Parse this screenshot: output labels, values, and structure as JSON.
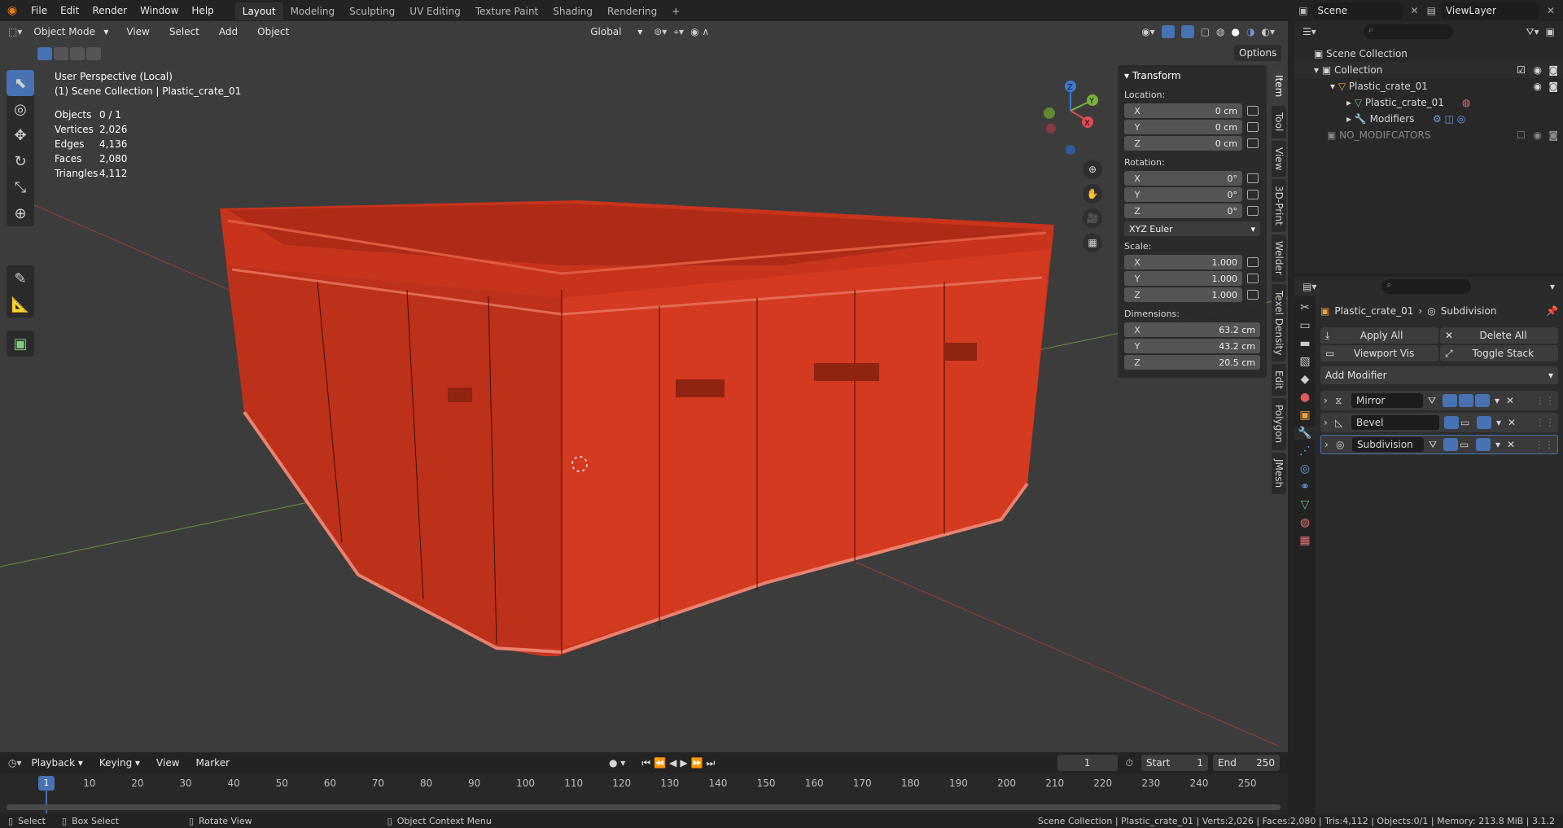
{
  "topmenu": {
    "items": [
      "File",
      "Edit",
      "Render",
      "Window",
      "Help"
    ],
    "workspaces": [
      "Layout",
      "Modeling",
      "Sculpting",
      "UV Editing",
      "Texture Paint",
      "Shading",
      "Rendering"
    ],
    "add_tab": "+",
    "scene": "Scene",
    "view_layer": "ViewLayer"
  },
  "viewport_header": {
    "mode": "Object Mode",
    "menus": [
      "View",
      "Select",
      "Add",
      "Object"
    ],
    "transform_orientation": "Global",
    "options": "Options"
  },
  "viewport": {
    "perspective": "User Perspective (Local)",
    "collection_line": "(1) Scene Collection | Plastic_crate_01",
    "stats": [
      {
        "label": "Objects",
        "value": "0 / 1"
      },
      {
        "label": "Vertices",
        "value": "2,026"
      },
      {
        "label": "Edges",
        "value": "4,136"
      },
      {
        "label": "Faces",
        "value": "2,080"
      },
      {
        "label": "Triangles",
        "value": "4,112"
      }
    ],
    "gizmo": {
      "x": "X",
      "y": "Y",
      "z": "Z"
    },
    "mesh_color": "#d9391f"
  },
  "npanel": {
    "title": "Transform",
    "location_label": "Location:",
    "location": [
      {
        "axis": "X",
        "value": "0 cm"
      },
      {
        "axis": "Y",
        "value": "0 cm"
      },
      {
        "axis": "Z",
        "value": "0 cm"
      }
    ],
    "rotation_label": "Rotation:",
    "rotation": [
      {
        "axis": "X",
        "value": "0°"
      },
      {
        "axis": "Y",
        "value": "0°"
      },
      {
        "axis": "Z",
        "value": "0°"
      }
    ],
    "rotation_mode": "XYZ Euler",
    "scale_label": "Scale:",
    "scale": [
      {
        "axis": "X",
        "value": "1.000"
      },
      {
        "axis": "Y",
        "value": "1.000"
      },
      {
        "axis": "Z",
        "value": "1.000"
      }
    ],
    "dimensions_label": "Dimensions:",
    "dimensions": [
      {
        "axis": "X",
        "value": "63.2 cm"
      },
      {
        "axis": "Y",
        "value": "43.2 cm"
      },
      {
        "axis": "Z",
        "value": "20.5 cm"
      }
    ],
    "tabs": [
      "Item",
      "Tool",
      "View",
      "3D-Print",
      "Welder",
      "Texel Density",
      "Edit",
      "Polygon",
      "JMesh"
    ]
  },
  "outliner": {
    "rows": [
      {
        "label": "Scene Collection"
      },
      {
        "label": "Collection"
      },
      {
        "label": "Plastic_crate_01"
      },
      {
        "label": "Plastic_crate_01"
      },
      {
        "label": "Modifiers"
      },
      {
        "label": "NO_MODIFCATORS"
      }
    ]
  },
  "properties": {
    "object": "Plastic_crate_01",
    "active_modifier": "Subdivision",
    "apply_all": "Apply All",
    "delete_all": "Delete All",
    "viewport_vis": "Viewport Vis",
    "toggle_stack": "Toggle Stack",
    "add_modifier": "Add Modifier",
    "modifiers": [
      {
        "name": "Mirror"
      },
      {
        "name": "Bevel"
      },
      {
        "name": "Subdivision"
      }
    ]
  },
  "timeline": {
    "menus": [
      "Playback",
      "Keying",
      "View",
      "Marker"
    ],
    "current_frame": "1",
    "start_label": "Start",
    "start": "1",
    "end_label": "End",
    "end": "250",
    "ticks": [
      "1",
      "10",
      "20",
      "30",
      "40",
      "50",
      "60",
      "70",
      "80",
      "90",
      "100",
      "110",
      "120",
      "130",
      "140",
      "150",
      "160",
      "170",
      "180",
      "190",
      "200",
      "210",
      "220",
      "230",
      "240",
      "250"
    ]
  },
  "statusbar": {
    "select": "Select",
    "box_select": "Box Select",
    "rotate_view": "Rotate View",
    "context_menu": "Object Context Menu",
    "info": "Scene Collection | Plastic_crate_01 | Verts:2,026 | Faces:2,080 | Tris:4,112 | Objects:0/1 | Memory: 213.8 MiB | 3.1.2"
  }
}
